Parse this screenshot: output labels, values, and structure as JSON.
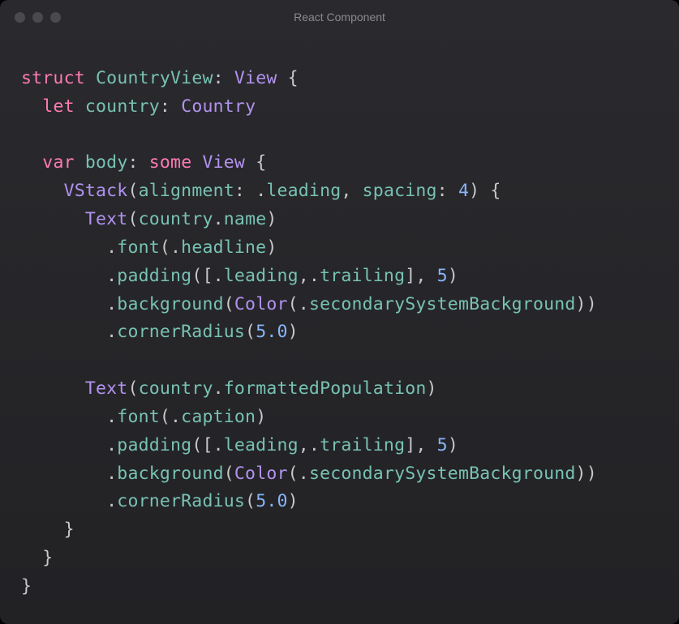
{
  "window": {
    "title": "React Component"
  },
  "syntax_colors": {
    "keyword": "#ff7ab2",
    "type": "#b392f0",
    "identifier": "#78c2b3",
    "number": "#89b4f8",
    "default": "#c7c7cc"
  },
  "code": {
    "tokens": [
      [
        [
          "kw-struct",
          "struct"
        ],
        [
          "punct",
          " "
        ],
        [
          "ident",
          "CountryView"
        ],
        [
          "punct",
          ": "
        ],
        [
          "type",
          "View"
        ],
        [
          "punct",
          " {"
        ]
      ],
      [
        [
          "punct",
          "  "
        ],
        [
          "kw-struct",
          "let"
        ],
        [
          "punct",
          " "
        ],
        [
          "ident",
          "country"
        ],
        [
          "punct",
          ": "
        ],
        [
          "type",
          "Country"
        ]
      ],
      [
        [
          "punct",
          ""
        ]
      ],
      [
        [
          "punct",
          "  "
        ],
        [
          "kw-struct",
          "var"
        ],
        [
          "punct",
          " "
        ],
        [
          "ident",
          "body"
        ],
        [
          "punct",
          ": "
        ],
        [
          "kw-struct",
          "some"
        ],
        [
          "punct",
          " "
        ],
        [
          "type",
          "View"
        ],
        [
          "punct",
          " {"
        ]
      ],
      [
        [
          "punct",
          "    "
        ],
        [
          "type",
          "VStack"
        ],
        [
          "punct",
          "("
        ],
        [
          "ident",
          "alignment"
        ],
        [
          "punct",
          ": ."
        ],
        [
          "ident",
          "leading"
        ],
        [
          "punct",
          ", "
        ],
        [
          "ident",
          "spacing"
        ],
        [
          "punct",
          ": "
        ],
        [
          "num",
          "4"
        ],
        [
          "punct",
          ") {"
        ]
      ],
      [
        [
          "punct",
          "      "
        ],
        [
          "type",
          "Text"
        ],
        [
          "punct",
          "("
        ],
        [
          "ident",
          "country"
        ],
        [
          "punct",
          "."
        ],
        [
          "ident",
          "name"
        ],
        [
          "punct",
          ")"
        ]
      ],
      [
        [
          "punct",
          "        ."
        ],
        [
          "method",
          "font"
        ],
        [
          "punct",
          "(."
        ],
        [
          "enumcase",
          "headline"
        ],
        [
          "punct",
          ")"
        ]
      ],
      [
        [
          "punct",
          "        ."
        ],
        [
          "method",
          "padding"
        ],
        [
          "punct",
          "([."
        ],
        [
          "enumcase",
          "leading"
        ],
        [
          "punct",
          ",."
        ],
        [
          "enumcase",
          "trailing"
        ],
        [
          "punct",
          "], "
        ],
        [
          "num",
          "5"
        ],
        [
          "punct",
          ")"
        ]
      ],
      [
        [
          "punct",
          "        ."
        ],
        [
          "method",
          "background"
        ],
        [
          "punct",
          "("
        ],
        [
          "type",
          "Color"
        ],
        [
          "punct",
          "(."
        ],
        [
          "enumcase",
          "secondarySystemBackground"
        ],
        [
          "punct",
          "))"
        ]
      ],
      [
        [
          "punct",
          "        ."
        ],
        [
          "method",
          "cornerRadius"
        ],
        [
          "punct",
          "("
        ],
        [
          "num",
          "5.0"
        ],
        [
          "punct",
          ")"
        ]
      ],
      [
        [
          "punct",
          ""
        ]
      ],
      [
        [
          "punct",
          "      "
        ],
        [
          "type",
          "Text"
        ],
        [
          "punct",
          "("
        ],
        [
          "ident",
          "country"
        ],
        [
          "punct",
          "."
        ],
        [
          "ident",
          "formattedPopulation"
        ],
        [
          "punct",
          ")"
        ]
      ],
      [
        [
          "punct",
          "        ."
        ],
        [
          "method",
          "font"
        ],
        [
          "punct",
          "(."
        ],
        [
          "enumcase",
          "caption"
        ],
        [
          "punct",
          ")"
        ]
      ],
      [
        [
          "punct",
          "        ."
        ],
        [
          "method",
          "padding"
        ],
        [
          "punct",
          "([."
        ],
        [
          "enumcase",
          "leading"
        ],
        [
          "punct",
          ",."
        ],
        [
          "enumcase",
          "trailing"
        ],
        [
          "punct",
          "], "
        ],
        [
          "num",
          "5"
        ],
        [
          "punct",
          ")"
        ]
      ],
      [
        [
          "punct",
          "        ."
        ],
        [
          "method",
          "background"
        ],
        [
          "punct",
          "("
        ],
        [
          "type",
          "Color"
        ],
        [
          "punct",
          "(."
        ],
        [
          "enumcase",
          "secondarySystemBackground"
        ],
        [
          "punct",
          "))"
        ]
      ],
      [
        [
          "punct",
          "        ."
        ],
        [
          "method",
          "cornerRadius"
        ],
        [
          "punct",
          "("
        ],
        [
          "num",
          "5.0"
        ],
        [
          "punct",
          ")"
        ]
      ],
      [
        [
          "punct",
          "    }"
        ]
      ],
      [
        [
          "punct",
          "  }"
        ]
      ],
      [
        [
          "punct",
          "}"
        ]
      ]
    ]
  }
}
